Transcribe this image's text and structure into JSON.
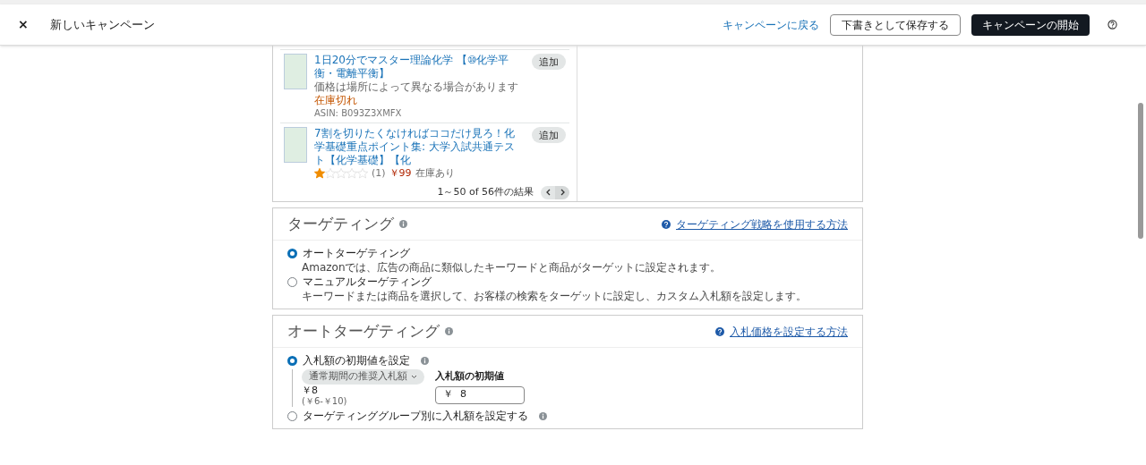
{
  "header": {
    "close": "×",
    "title": "新しいキャンペーン",
    "back_link": "キャンペーンに戻る",
    "save_draft": "下書きとして保存する",
    "start": "キャンペーンの開始"
  },
  "products": {
    "items": [
      {
        "kind": "stock-note",
        "title": "1日20分でマスター理論化学 【⑩化学平衡・電離平衡】",
        "note": "価格は場所によって異なる場合があります",
        "stock": "在庫切れ",
        "asin": "ASIN: B093Z3XMFX",
        "add": "追加"
      },
      {
        "kind": "rated",
        "title": "7割を切りたくなければココだけ見ろ！化学基礎重点ポイント集: 大学入試共通テスト【化学基礎】【化",
        "stars": 1,
        "reviews": "(1)",
        "price": "￥99",
        "stock": "在庫あり",
        "add": "追加"
      }
    ],
    "pagination": "1～50 of 56件の結果"
  },
  "targeting": {
    "title": "ターゲティング",
    "help_link": "ターゲティング戦略を使用する方法",
    "options": [
      {
        "label": "オートターゲティング",
        "description": "Amazonでは、広告の商品に類似したキーワードと商品がターゲットに設定されます。",
        "selected": true
      },
      {
        "label": "マニュアルターゲティング",
        "description": "キーワードまたは商品を選択して、お客様の検索をターゲットに設定し、カスタム入札額を設定します。",
        "selected": false
      }
    ]
  },
  "auto_targeting": {
    "title": "オートターゲティング",
    "help_link": "入札価格を設定する方法",
    "options": [
      {
        "label": "入札額の初期値を設定",
        "selected": true
      },
      {
        "label": "ターゲティンググループ別に入札額を設定する",
        "selected": false
      }
    ],
    "suggested": {
      "dropdown": "通常期間の推奨入札額",
      "value": "￥8",
      "range": "(￥6-￥10)"
    },
    "default_bid": {
      "label": "入札額の初期値",
      "currency": "￥",
      "value": "8"
    }
  }
}
